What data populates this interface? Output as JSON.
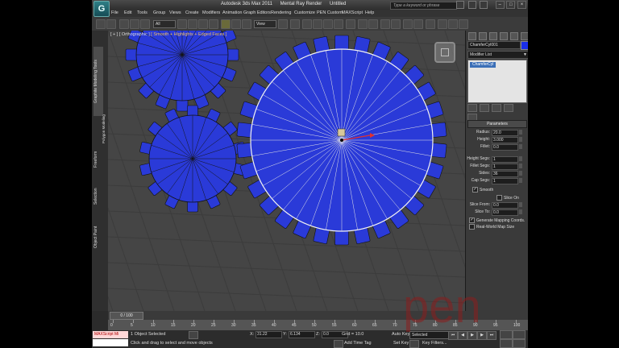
{
  "window": {
    "app_logo": "G",
    "title_product": "Autodesk 3ds Max 2011",
    "title_renderer": "Mental Ray Render",
    "title_file": "Untitled",
    "search_placeholder": "Type a keyword or phrase",
    "controls": [
      "–",
      "□",
      "×"
    ]
  },
  "menu": [
    "File",
    "Edit",
    "Tools",
    "Group",
    "Views",
    "Create",
    "Modifiers",
    "Animation",
    "Graph Editors",
    "Rendering",
    "Customize",
    "PEN Custom",
    "MAXScript",
    "Help"
  ],
  "toolbar": {
    "selection_filter": "All",
    "reference_coord": "View"
  },
  "ribbon_tabs": [
    "Graphite Modeling Tools",
    "Freeform",
    "Selection",
    "Object Paint"
  ],
  "ribbon_sub": "Polygon Modeling",
  "viewport": {
    "label_bracket": "[ + ] [ Orthographic ]",
    "label_shading": "[ Smooth + Highlights + Edged Faces ]",
    "bg_color": "#454545",
    "gear_color": "#2a3ad8"
  },
  "command_panel": {
    "object_name": "ChamferCyl001",
    "object_color": "#1a2ee8",
    "modifier_list_label": "Modifier List",
    "stack_item": "ChamferCyl",
    "rollout_title": "Parameters",
    "params": [
      {
        "label": "Radius:",
        "value": "20.0"
      },
      {
        "label": "Height:",
        "value": "3.000"
      },
      {
        "label": "Fillet:",
        "value": "0.0"
      },
      {
        "label": "Height Segs:",
        "value": "1"
      },
      {
        "label": "Fillet Segs:",
        "value": "1"
      },
      {
        "label": "Sides:",
        "value": "36"
      },
      {
        "label": "Cap Segs:",
        "value": "1"
      }
    ],
    "smooth_label": "Smooth",
    "slice_on_label": "Slice On",
    "slice_from_label": "Slice From:",
    "slice_from_value": "0.0",
    "slice_to_label": "Slice To:",
    "slice_to_value": "0.0",
    "gen_mapping_label": "Generate Mapping Coords.",
    "real_world_label": "Real-World Map Size"
  },
  "timeline": {
    "slider_label": "0 / 100",
    "ticks": [
      "0",
      "5",
      "10",
      "15",
      "20",
      "25",
      "30",
      "35",
      "40",
      "45",
      "50",
      "55",
      "60",
      "65",
      "70",
      "75",
      "80",
      "85",
      "90",
      "95",
      "100"
    ]
  },
  "status": {
    "maxscript_label": "MAXScript Mi",
    "selected_text": "1 Object Selected",
    "prompt_text": "Click and drag to select and move objects",
    "x_label": "X:",
    "x_value": "31.22",
    "y_label": "Y:",
    "y_value": "6.134",
    "z_label": "Z:",
    "z_value": "0.0",
    "grid_label": "Grid = 10.0",
    "add_time_tag": "Add Time Tag",
    "auto_key": "Auto Key",
    "set_key": "Set Key",
    "selected_dd": "Selected",
    "key_filters": "Key Filters..."
  },
  "watermark_text": "pen"
}
